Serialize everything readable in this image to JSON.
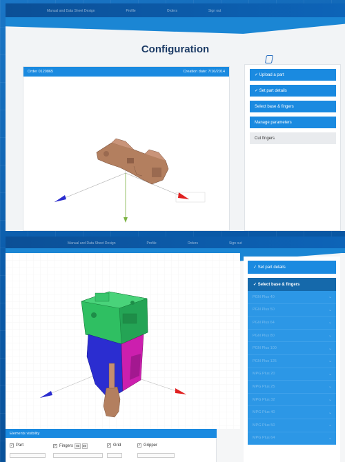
{
  "nav": [
    "Manual and Data Sheet Design",
    "Profile",
    "Orders",
    "Sign out"
  ],
  "page_title": "Configuration",
  "order_bar": {
    "order": "Order 0120865",
    "creation": "Creation date: 7/16/2014"
  },
  "steps_top": [
    "✓ Upload a part",
    "✓ Set part details",
    "Select base & fingers",
    "Manage parameters",
    "Cut fingers"
  ],
  "steps_panel2": {
    "set_details": "✓ Set part details",
    "select_base": "✓ Select base & fingers"
  },
  "packages": [
    "PGN Plus 40",
    "PGN Plus 50",
    "PGN Plus 64",
    "PGN Plus 80",
    "PGN Plus 100",
    "PGN Plus 125",
    "MPG Plus 20",
    "MPG Plus 25",
    "MPG Plus 32",
    "MPG Plus 40",
    "MPG Plus 50",
    "MPG Plus 64"
  ],
  "elements_visibility": "Elements visibility",
  "checkboxes": {
    "part": "Part",
    "fingers": "Fingers",
    "grid": "Grid",
    "gripper": "Gripper"
  },
  "mini_btns": [
    "◂◂",
    "▸▸"
  ],
  "colors": {
    "accent": "#1a8ae0",
    "title": "#1d3c66",
    "part": "#b07a5a",
    "gripper_green": "#27b45a",
    "gripper_blue": "#2a2ccf",
    "gripper_magenta": "#d01eaa"
  }
}
